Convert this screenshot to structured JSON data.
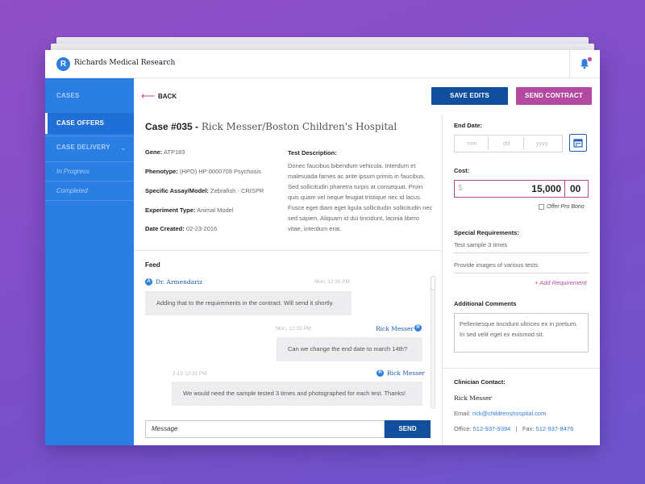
{
  "header": {
    "logo_letter": "R",
    "org_name": "Richards Medical Research"
  },
  "sidebar": {
    "items": [
      {
        "label": "CASES"
      },
      {
        "label": "CASE OFFERS"
      },
      {
        "label": "CASE DELIVERY"
      }
    ],
    "sub_items": [
      {
        "label": "In Progress"
      },
      {
        "label": "Completed"
      }
    ]
  },
  "toolbar": {
    "back_label": "BACK",
    "save_label": "SAVE EDITS",
    "send_label": "SEND CONTRACT"
  },
  "case": {
    "number": "Case #035 -",
    "title": "Rick Messer/Boston Children's Hospital",
    "fields": [
      {
        "key": "Gene:",
        "value": "ATP183"
      },
      {
        "key": "Phenotype:",
        "value": "(HPO) HP:0000709 Psychosis"
      },
      {
        "key": "Specific Assay/Model:",
        "value": "Zebrafish - CRISPR"
      },
      {
        "key": "Experiment Type:",
        "value": "Animal Model"
      },
      {
        "key": "Date Created:",
        "value": "02-23-2016"
      }
    ],
    "description_heading": "Test Description:",
    "description": "Donec faucibus bibendum vehicula. Interdum et malesuada fames ac ante ipsum primis in faucibus. Sed sollicitudin pharetra turpis at consequat. Proin quis quam vel neque feugiat tristique nec id lacus. Fusce eget diam eget ligula sollicitudin sollicitudin nec sed sapien. Aliquam id dui tincidunt, lacinia libero vitae, interdum erat."
  },
  "feed": {
    "heading": "Feed",
    "messages": [
      {
        "avatar": "A",
        "author": "Dr. Armendariz",
        "time": "Mon, 12:30 PM",
        "text": "Adding that to the requirements in the contract. Will send it shortly."
      },
      {
        "avatar": "R",
        "author": "Rick Messer",
        "time": "Mon, 12:33 PM",
        "text": "Can we change the end date to march 14th?"
      },
      {
        "avatar": "R",
        "author": "Rick Messer",
        "time": "2-13 12:25 PM",
        "text": "We would need the sample tested 3 times and photographed for each test. Thanks!"
      }
    ],
    "input_placeholder": "Message",
    "send_label": "SEND"
  },
  "contract": {
    "end_date_label": "End Date:",
    "date_placeholders": {
      "mm": "mm",
      "dd": "dd",
      "yyyy": "yyyy"
    },
    "cost_label": "Cost:",
    "currency_symbol": "$",
    "cost_value": "15,000",
    "cost_cents": "00",
    "pro_bono_label": "Offer Pro Bono",
    "requirements_label": "Special Requirements:",
    "requirements": [
      "Test sample 3 times",
      "Provide images of various tests"
    ],
    "add_requirement": "+ Add Requirement",
    "comments_label": "Additional Comments",
    "comments": "Pellentesque tincidunt ultrices ex in pretium. In sed velit eget ex euismod sit.",
    "clinician": {
      "heading": "Clinician Contact:",
      "name": "Rick Messer",
      "email_label": "Email:",
      "email": "rick@childrenshospital.com",
      "office_label": "Office:",
      "office": "512-937-9394",
      "separator": "|",
      "fax_label": "Fax:",
      "fax": "512-937-8476"
    }
  },
  "colors": {
    "sidebar": "#2b7fe3",
    "primary_button": "#0f4f9d",
    "accent": "#b44a9f"
  }
}
